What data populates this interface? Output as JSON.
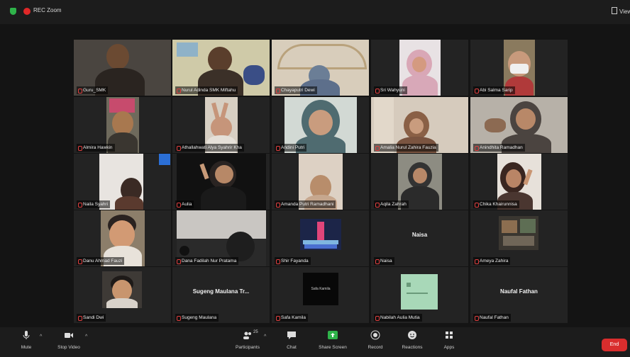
{
  "topbar": {
    "recording_label": "REC Zoom",
    "view_label": "View"
  },
  "participants": [
    {
      "name": "Guru_SMK"
    },
    {
      "name": "Nurul Adinda SMK Miftahu"
    },
    {
      "name": "Chayaputri Dewi"
    },
    {
      "name": "Sri Wahyuni"
    },
    {
      "name": "Abi Salma Sarip"
    },
    {
      "name": "Almira Hawkin"
    },
    {
      "name": "Athallahwati Alya Syahrir Kha"
    },
    {
      "name": "Andini Putri"
    },
    {
      "name": "Amalia Nurul Zahira Fauzia"
    },
    {
      "name": "Anindhita Ramadhan"
    },
    {
      "name": "Naila Syahri"
    },
    {
      "name": "Aulia"
    },
    {
      "name": "Amanda Putri Ramadhani"
    },
    {
      "name": "Aqila Zahrah"
    },
    {
      "name": "Chika Khairunnisa"
    },
    {
      "name": "Danu Ahmad Fauzi"
    },
    {
      "name": "Dana Fadilah Nur Pratama"
    },
    {
      "name": "Shir Fayanda"
    },
    {
      "name": "Naisa",
      "screen_text": "Naisa"
    },
    {
      "name": "Ameya Zahira"
    },
    {
      "name": "Sandi Dwi"
    },
    {
      "name": "Sugeng Maulana",
      "screen_text": "Sugeng Maulana Tr..."
    },
    {
      "name": "Safa Kamila",
      "screen_text": "Safa Kamila"
    },
    {
      "name": "Nabilah Aulia Mutia"
    },
    {
      "name": "Naufal Fathan",
      "screen_text": "Naufal Fathan"
    }
  ],
  "toolbar": {
    "mute": "Mute",
    "stop_video": "Stop Video",
    "participants": "Participants",
    "chat": "Chat",
    "share_screen": "Share Screen",
    "record": "Record",
    "reactions": "Reactions",
    "apps": "Apps",
    "end": "End",
    "participants_count": "25"
  },
  "colors": {
    "active_border": "#9bd35a",
    "end_button": "#d92d2d",
    "share_green": "#2fb34a"
  }
}
